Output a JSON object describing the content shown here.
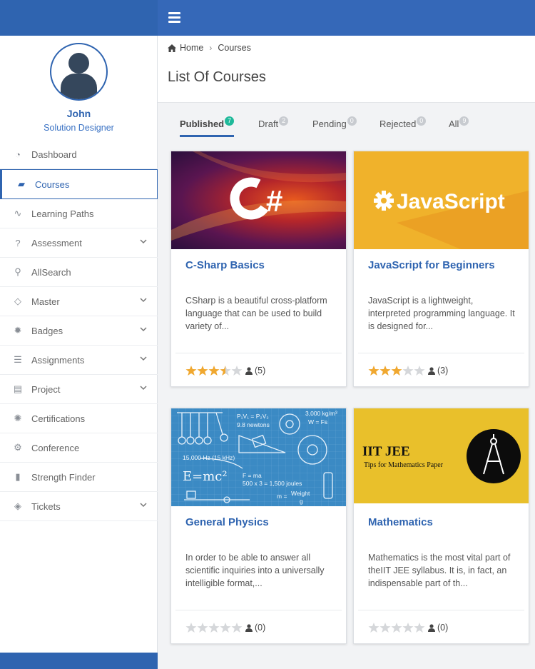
{
  "user": {
    "name": "John",
    "role": "Solution Designer"
  },
  "sidebar": {
    "items": [
      {
        "label": "Dashboard",
        "icon": "dashboard-icon",
        "expandable": false
      },
      {
        "label": "Courses",
        "icon": "book-icon",
        "expandable": false,
        "active": true
      },
      {
        "label": "Learning Paths",
        "icon": "line-chart-icon",
        "expandable": false
      },
      {
        "label": "Assessment",
        "icon": "question-circle-icon",
        "expandable": true
      },
      {
        "label": "AllSearch",
        "icon": "search-icon",
        "expandable": false
      },
      {
        "label": "Master",
        "icon": "diamond-icon",
        "expandable": true
      },
      {
        "label": "Badges",
        "icon": "badge-icon",
        "expandable": true
      },
      {
        "label": "Assignments",
        "icon": "list-icon",
        "expandable": true
      },
      {
        "label": "Project",
        "icon": "id-card-icon",
        "expandable": true
      },
      {
        "label": "Certifications",
        "icon": "certificate-icon",
        "expandable": false
      },
      {
        "label": "Conference",
        "icon": "cogs-icon",
        "expandable": false
      },
      {
        "label": "Strength Finder",
        "icon": "file-icon",
        "expandable": false
      },
      {
        "label": "Tickets",
        "icon": "ticket-icon",
        "expandable": true
      }
    ]
  },
  "breadcrumb": {
    "home": "Home",
    "current": "Courses"
  },
  "page_title": "List Of Courses",
  "tabs": [
    {
      "label": "Published",
      "count": "7",
      "active": true
    },
    {
      "label": "Draft",
      "count": "2"
    },
    {
      "label": "Pending",
      "count": "0"
    },
    {
      "label": "Rejected",
      "count": "0"
    },
    {
      "label": "All",
      "count": "9"
    }
  ],
  "courses": [
    {
      "title": "C-Sharp Basics",
      "description": "CSharp is a beautiful cross-platform language that can be used to build variety of...",
      "rating": 3.5,
      "reviews": "(5)",
      "thumb_text": "C#"
    },
    {
      "title": "JavaScript for Beginners",
      "description": "JavaScript is a lightweight, interpreted programming language. It is designed for...",
      "rating": 3,
      "reviews": "(3)",
      "thumb_text": "JavaScript"
    },
    {
      "title": "General Physics",
      "description": "In order to be able to answer all scientific inquiries into a universally intelligible format,...",
      "rating": 0,
      "reviews": "(0)",
      "thumb_lines": [
        "P1V1 = P2V2",
        "3,000 kg/m³",
        "W = Fs",
        "9.8 newtons",
        "15,000 Hz (15 kHz)",
        "E=mc²",
        "F = ma",
        "500 x 3 = 1,500 joules",
        "m = Weight / g"
      ]
    },
    {
      "title": "Mathematics",
      "description": "Mathematics is the most vital part of theIIT JEE syllabus. It is, in fact, an indispensable part of th...",
      "rating": 0,
      "reviews": "(0)",
      "thumb_title": "IIT JEE",
      "thumb_sub": "Tips for Mathematics Paper"
    }
  ],
  "colors": {
    "primary": "#2f64b0",
    "star": "#f0a830",
    "star_empty": "#d5d7da",
    "badge_active": "#1fb99a"
  }
}
